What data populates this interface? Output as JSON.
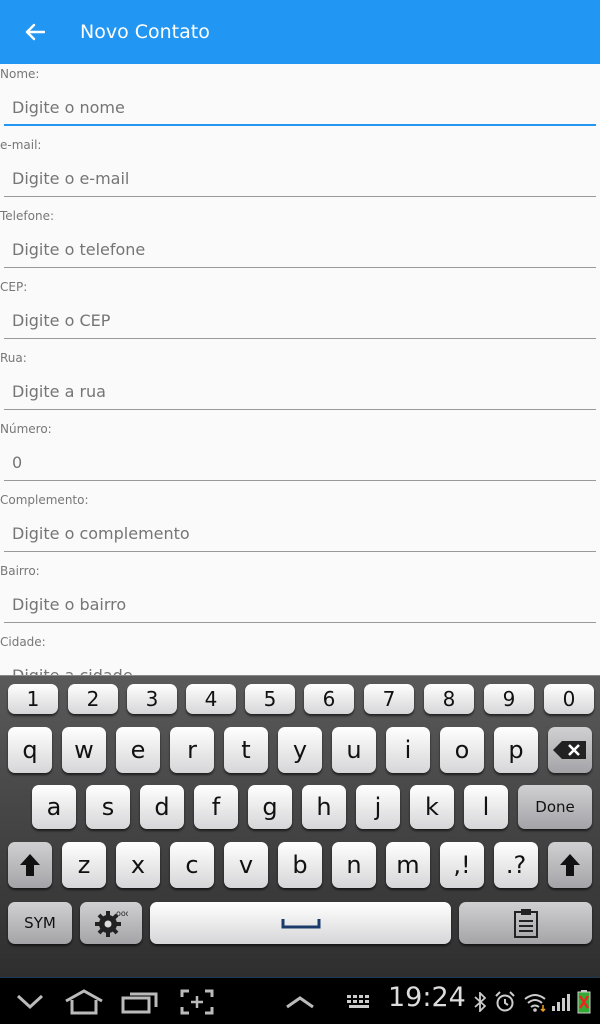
{
  "app_bar": {
    "title": "Novo Contato"
  },
  "fields": [
    {
      "label": "Nome:",
      "placeholder": "Digite o nome"
    },
    {
      "label": "e-mail:",
      "placeholder": "Digite o e-mail"
    },
    {
      "label": "Telefone:",
      "placeholder": "Digite o telefone"
    },
    {
      "label": "CEP:",
      "placeholder": "Digite o CEP"
    },
    {
      "label": "Rua:",
      "placeholder": "Digite a rua"
    },
    {
      "label": "Número:",
      "placeholder": "0"
    },
    {
      "label": "Complemento:",
      "placeholder": "Digite o complemento"
    },
    {
      "label": "Bairro:",
      "placeholder": "Digite o bairro"
    },
    {
      "label": "Cidade:",
      "placeholder": "Digite a cidade"
    }
  ],
  "keyboard": {
    "numbers": [
      "1",
      "2",
      "3",
      "4",
      "5",
      "6",
      "7",
      "8",
      "9",
      "0"
    ],
    "row1": [
      "q",
      "w",
      "e",
      "r",
      "t",
      "y",
      "u",
      "i",
      "o",
      "p"
    ],
    "row2": [
      "a",
      "s",
      "d",
      "f",
      "g",
      "h",
      "j",
      "k",
      "l"
    ],
    "row3": [
      "z",
      "x",
      "c",
      "v",
      "b",
      "n",
      "m"
    ],
    "comma": ",!",
    "period": ".?",
    "done": "Done",
    "sym": "SYM"
  },
  "status": {
    "time": "19:24"
  },
  "colors": {
    "accent": "#2196f3",
    "appbar": "#2196f3"
  }
}
